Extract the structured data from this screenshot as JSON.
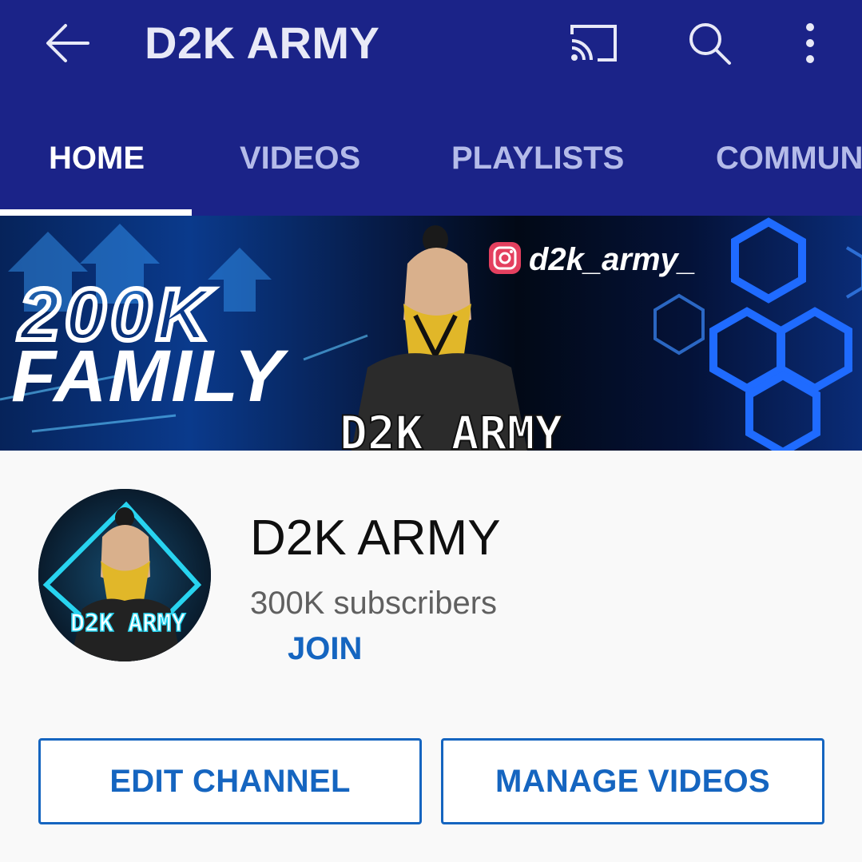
{
  "appbar": {
    "title": "D2K ARMY"
  },
  "icons": {
    "back": "arrow-back-icon",
    "cast": "cast-icon",
    "search": "search-icon",
    "more": "more-vert-icon"
  },
  "tabs": [
    {
      "label": "HOME",
      "active": true
    },
    {
      "label": "VIDEOS",
      "active": false
    },
    {
      "label": "PLAYLISTS",
      "active": false
    },
    {
      "label": "COMMUN",
      "active": false
    }
  ],
  "banner": {
    "headline_top": "200K",
    "headline_bottom": "FAMILY",
    "instagram_handle": "d2k_army_",
    "logo_text": "D2K ARMY"
  },
  "channel": {
    "name": "D2K ARMY",
    "subscribers": "300K subscribers",
    "join_label": "JOIN",
    "avatar_text": "D2K ARMY"
  },
  "actions": {
    "edit_label": "EDIT CHANNEL",
    "manage_label": "MANAGE VIDEOS"
  },
  "colors": {
    "appbar": "#1b2388",
    "accent": "#1565c0",
    "tab_inactive": "#b4bbe9"
  }
}
